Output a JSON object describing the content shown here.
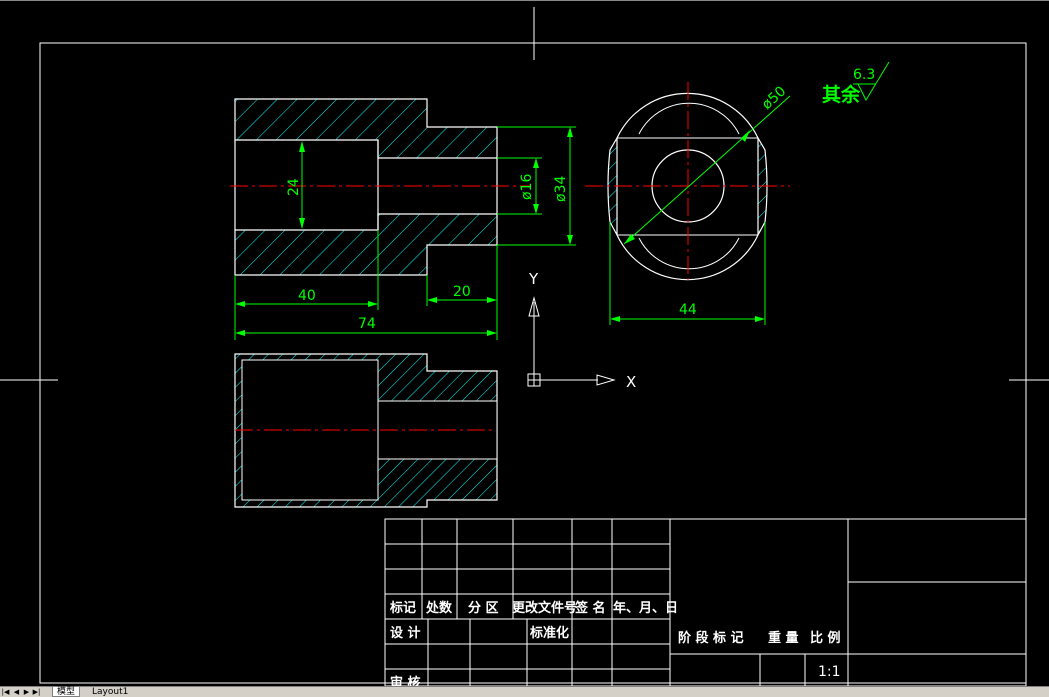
{
  "colors": {
    "background": "#000000",
    "frame": "#ffffff",
    "dimension": "#00ff00",
    "hatch": "#00ffff",
    "centerline": "#ff0000",
    "outline": "#ffffff"
  },
  "drawing": {
    "dimensions": {
      "bore_height": "24",
      "hole_dia": "ø16",
      "outer_dia": "ø34",
      "bore_depth": "40",
      "shaft_length": "20",
      "total_length": "74",
      "circle_dia": "ø50",
      "flat_width": "44"
    },
    "roughness": {
      "label": "其余",
      "value": "6.3"
    },
    "ucs": {
      "x_label": "X",
      "y_label": "Y"
    }
  },
  "title_block": {
    "rev_headers": [
      "标记",
      "处数",
      "分 区",
      "更改文件号",
      "签 名",
      "年、月、日"
    ],
    "design_label": "设 计",
    "standard_label": "标准化",
    "review_label": "审 核",
    "stage_headers": [
      "阶 段 标 记",
      "重 量",
      "比 例"
    ],
    "scale_value": "1:1"
  },
  "tabs": {
    "items": [
      "模型",
      "Layout1"
    ],
    "active": 0
  },
  "nav_icons": [
    "first-tab-icon",
    "prev-tab-icon",
    "next-tab-icon",
    "last-tab-icon"
  ]
}
